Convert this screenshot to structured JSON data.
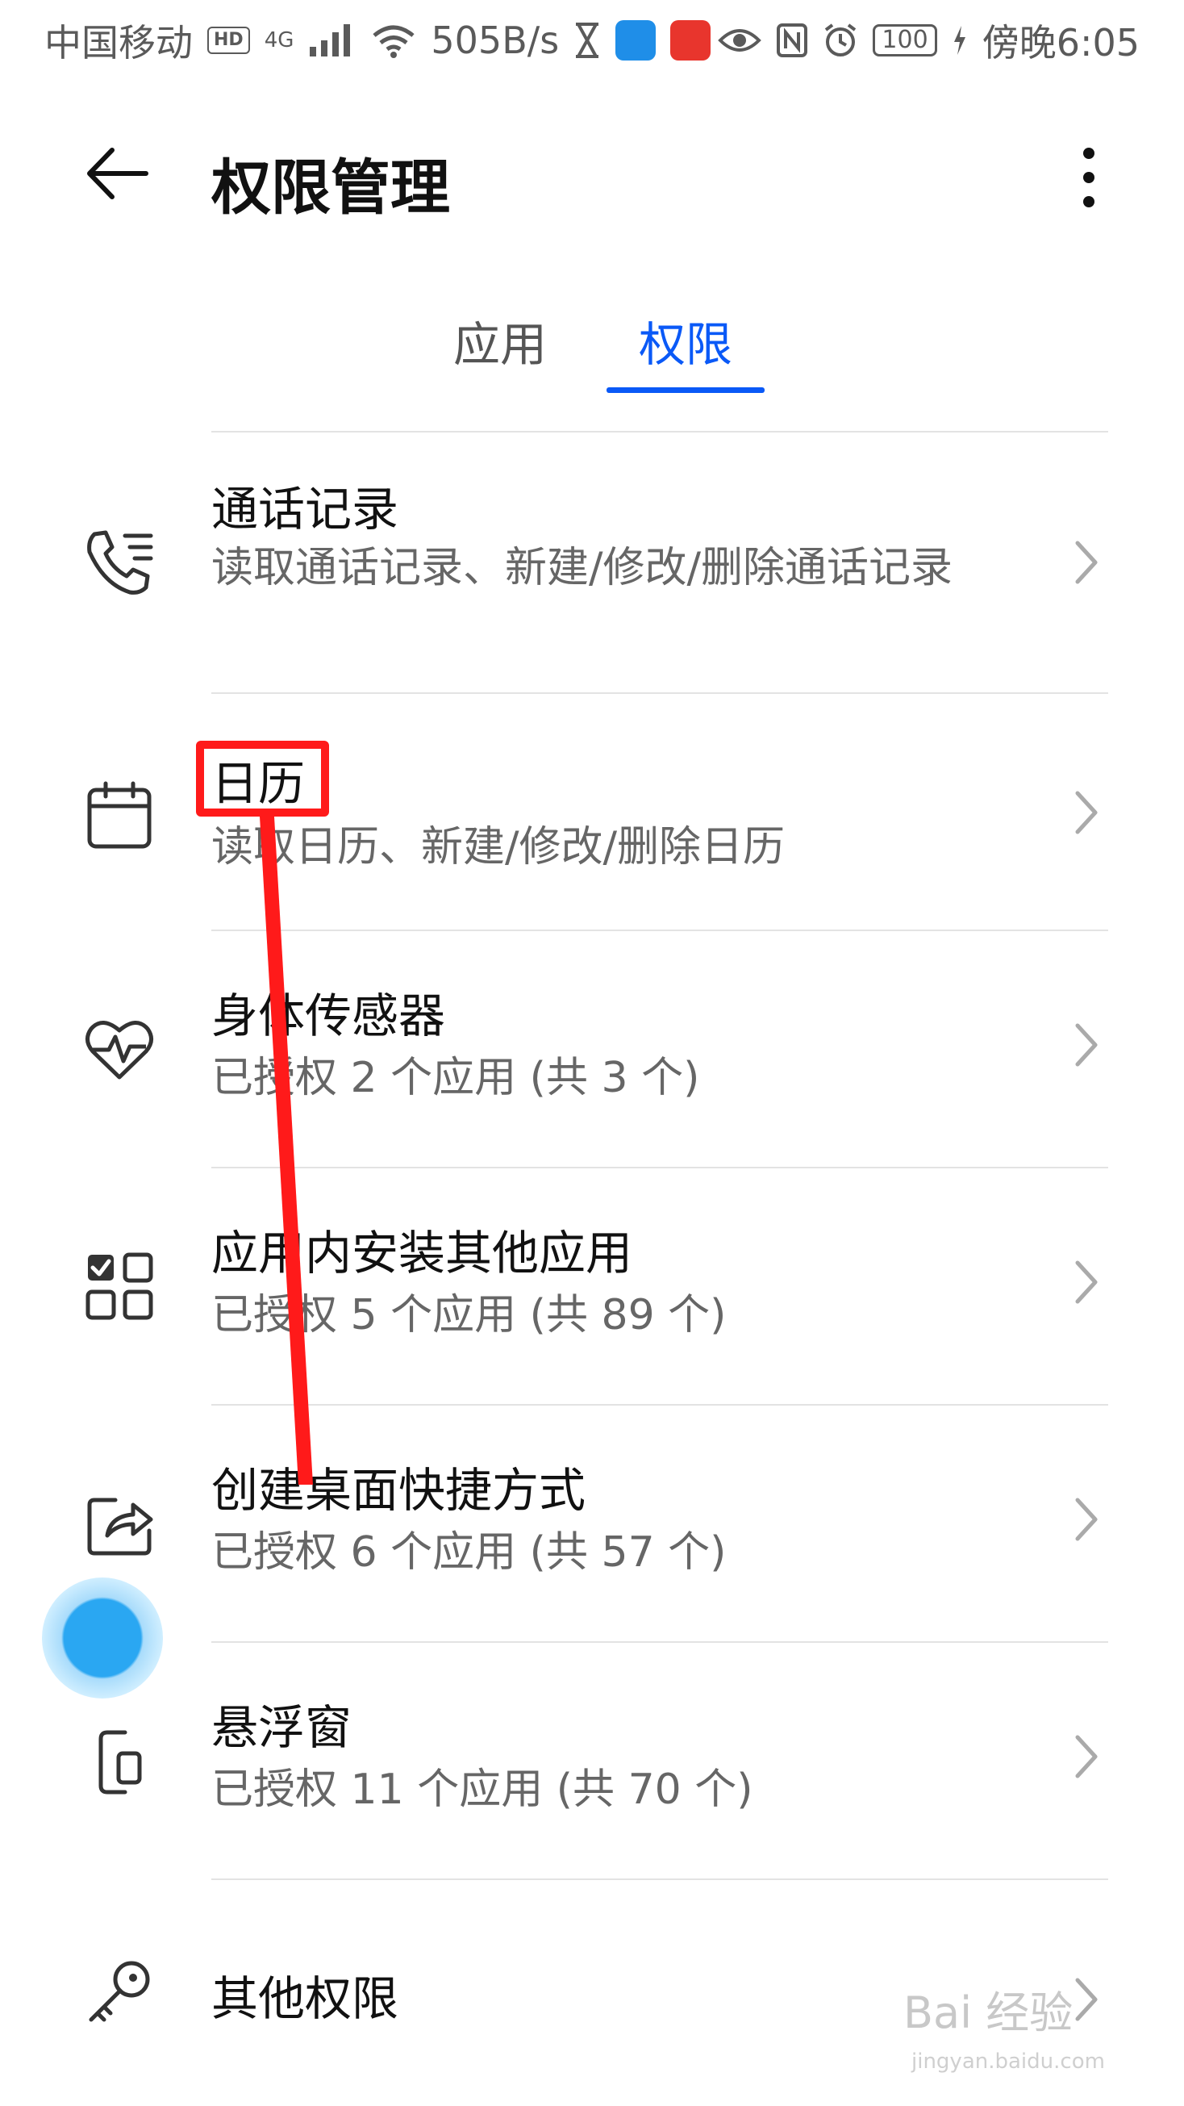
{
  "status_bar": {
    "carrier": "中国移动",
    "hd": "HD",
    "network": "4G",
    "speed": "505B/s",
    "battery": "100",
    "time": "傍晚6:05"
  },
  "header": {
    "title": "权限管理"
  },
  "tabs": [
    {
      "label": "应用",
      "active": false
    },
    {
      "label": "权限",
      "active": true
    }
  ],
  "permissions": [
    {
      "title": "通话记录",
      "subtitle": "读取通话记录、新建/修改/删除通话记录",
      "icon": "call-log-icon"
    },
    {
      "title": "日历",
      "subtitle": "读取日历、新建/修改/删除日历",
      "icon": "calendar-icon"
    },
    {
      "title": "身体传感器",
      "subtitle": "已授权 2 个应用 (共 3 个)",
      "icon": "heart-rate-icon"
    },
    {
      "title": "应用内安装其他应用",
      "subtitle": "已授权 5 个应用 (共 89 个)",
      "icon": "install-apps-icon"
    },
    {
      "title": "创建桌面快捷方式",
      "subtitle": "已授权 6 个应用 (共 57 个)",
      "icon": "shortcut-icon"
    },
    {
      "title": "悬浮窗",
      "subtitle": "已授权 11 个应用 (共 70 个)",
      "icon": "floating-window-icon"
    },
    {
      "title": "其他权限",
      "subtitle": "",
      "icon": "key-icon"
    }
  ],
  "watermark": {
    "brand": "Bai 经验",
    "url": "jingyan.baidu.com"
  },
  "colors": {
    "accent": "#0a59f7",
    "annotation": "#ff1a1a"
  }
}
